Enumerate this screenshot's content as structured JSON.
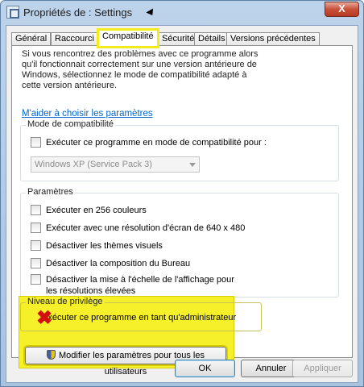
{
  "window": {
    "title": "Propriétés de : Settings",
    "close_label": "X"
  },
  "tabs": [
    "Général",
    "Raccourci",
    "Compatibilité",
    "Sécurité",
    "Détails",
    "Versions précédentes"
  ],
  "active_tab": "Compatibilité",
  "intro": "Si vous rencontrez des problèmes avec ce programme alors qu'il fonctionnait correctement sur une version antérieure de Windows, sélectionnez le mode de compatibilité adapté à cette version antérieure.",
  "help_link": "M'aider à choisir les paramètres",
  "compat_group": {
    "title": "Mode de compatibilité",
    "checkbox_label": "Exécuter ce programme en mode de compatibilité pour :",
    "dropdown_value": "Windows XP (Service Pack 3)"
  },
  "settings_group": {
    "title": "Paramètres",
    "options": [
      "Exécuter en 256 couleurs",
      "Exécuter avec une résolution d'écran de 640 x 480",
      "Désactiver les thèmes visuels",
      "Désactiver la composition du Bureau",
      "Désactiver la mise à l'échelle de l'affichage pour les résolutions élevées"
    ]
  },
  "privilege_group": {
    "title": "Niveau de privilège",
    "checkbox_label": "Exécuter ce programme en tant qu'administrateur"
  },
  "change_all_users_button": "Modifier les paramètres pour tous les utilisateurs",
  "buttons": {
    "ok": "OK",
    "cancel": "Annuler",
    "apply": "Appliquer"
  },
  "colors": {
    "highlight": "#f6f02a",
    "mark": "#d40f0f",
    "link": "#0066cc"
  }
}
